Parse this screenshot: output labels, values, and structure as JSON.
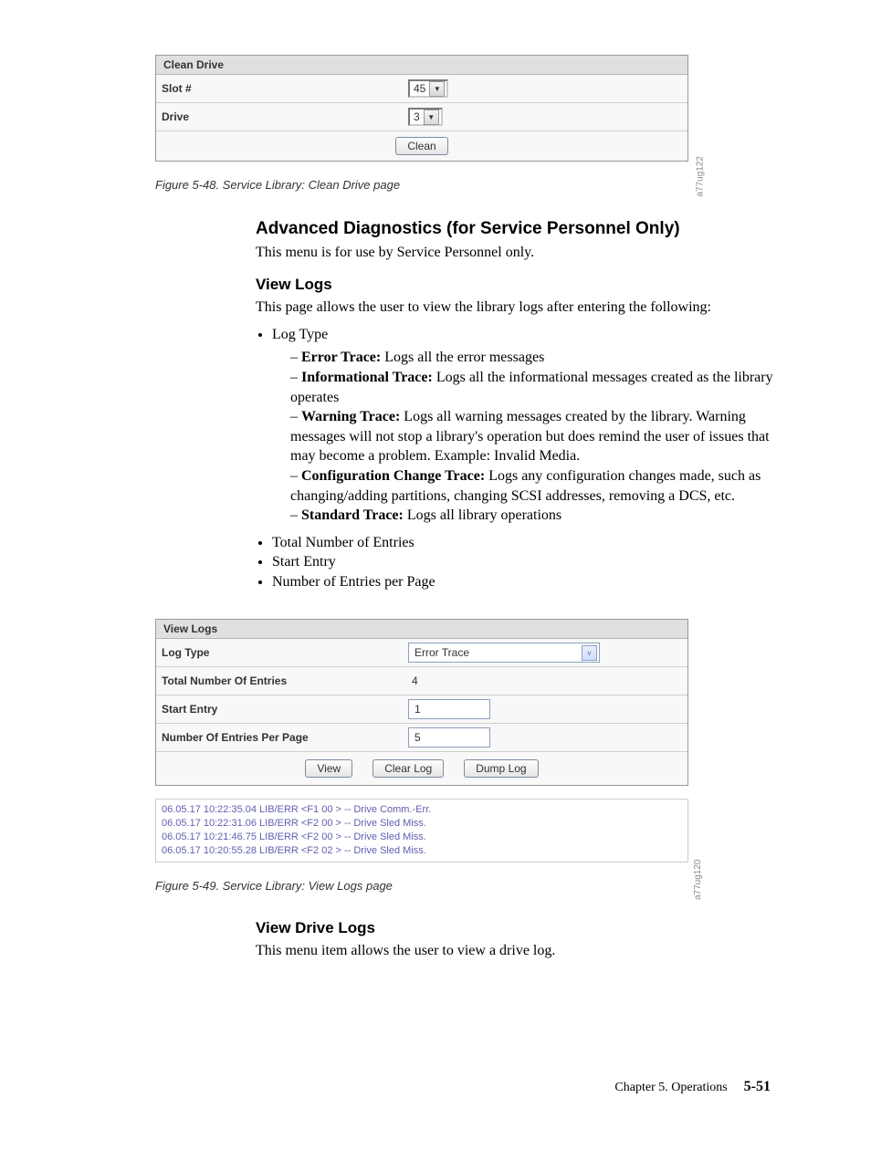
{
  "clean_drive": {
    "title": "Clean Drive",
    "slot_label": "Slot #",
    "slot_value": "45",
    "drive_label": "Drive",
    "drive_value": "3",
    "clean_button": "Clean",
    "side_code": "a77ug122"
  },
  "figure48": "Figure 5-48. Service Library: Clean Drive page",
  "section_adv_diag": {
    "heading": "Advanced Diagnostics (for Service Personnel Only)",
    "text": "This menu is for use by Service Personnel only."
  },
  "section_view_logs": {
    "heading": "View Logs",
    "intro": "This page allows the user to view the library logs after entering the following:",
    "li_log_type": "Log Type",
    "error_trace_label": "Error Trace:",
    "error_trace_text": " Logs all the error messages",
    "info_trace_label": "Informational Trace:",
    "info_trace_text": " Logs all the informational messages created as the library operates",
    "warn_trace_label": "Warning Trace:",
    "warn_trace_text": " Logs all warning messages created by the library. Warning messages will not stop a library's operation but does remind the user of issues that may become a problem. Example: Invalid Media.",
    "config_trace_label": "Configuration Change Trace:",
    "config_trace_text": " Logs any configuration changes made, such as changing/adding partitions, changing SCSI addresses, removing a DCS, etc.",
    "std_trace_label": "Standard Trace:",
    "std_trace_text": " Logs all library operations",
    "li_total": "Total Number of Entries",
    "li_start": "Start Entry",
    "li_perpage": "Number of Entries per Page"
  },
  "view_logs_panel": {
    "title": "View Logs",
    "log_type_label": "Log Type",
    "log_type_value": "Error Trace",
    "total_label": "Total Number Of Entries",
    "total_value": "4",
    "start_label": "Start Entry",
    "start_value": "1",
    "perpage_label": "Number Of Entries Per Page",
    "perpage_value": "5",
    "view_button": "View",
    "clear_button": "Clear Log",
    "dump_button": "Dump Log"
  },
  "log_output": {
    "line1": "06.05.17 10:22:35.04 LIB/ERR <F1 00 > -- Drive Comm.-Err.",
    "line2": "06.05.17 10:22:31.06 LIB/ERR <F2 00 > -- Drive Sled Miss.",
    "line3": "06.05.17 10:21:46.75 LIB/ERR <F2 00 > -- Drive Sled Miss.",
    "line4": "06.05.17 10:20:55.28 LIB/ERR <F2 02 > -- Drive Sled Miss.",
    "side_code": "a77ug120"
  },
  "figure49": "Figure 5-49. Service Library: View Logs page",
  "section_view_drive_logs": {
    "heading": "View Drive Logs",
    "text": "This menu item allows the user to view a drive log."
  },
  "footer": {
    "chapter": "Chapter 5. Operations",
    "page": "5-51"
  }
}
